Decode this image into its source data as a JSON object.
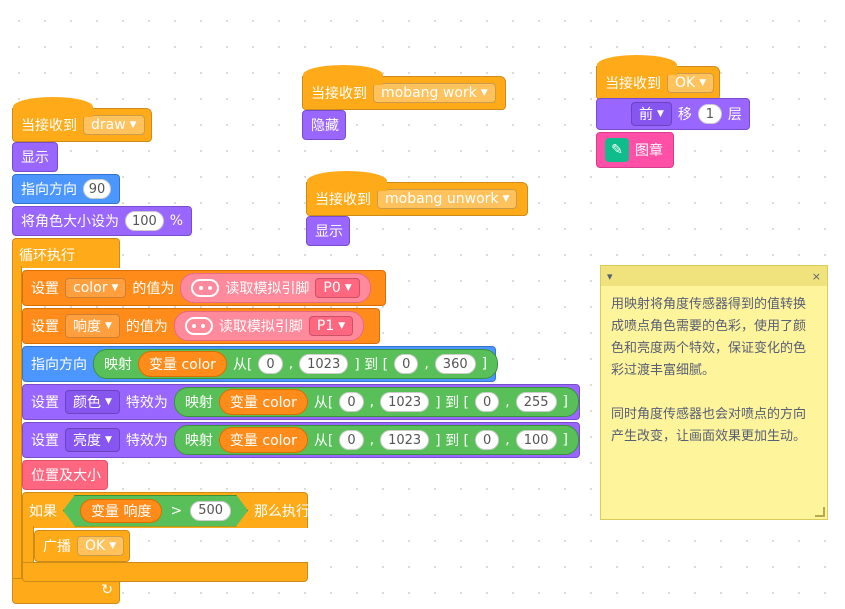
{
  "colors": {
    "events": "#ffab19",
    "looks": "#9966ff",
    "motion": "#4c97ff",
    "control": "#ffab19",
    "variables": "#ff8c1a",
    "operators": "#59c059",
    "pen": "#ff6680",
    "note_bg": "#fef49c"
  },
  "script_draw": {
    "hat_label": "当接收到",
    "hat_message": "draw",
    "show": "显示",
    "point_dir": "指向方向",
    "point_dir_value": "90",
    "set_size": "将角色大小设为",
    "set_size_value": "100",
    "set_size_unit": "%",
    "forever": "循环执行",
    "set1": "设置",
    "set1_var": "color",
    "set1_mid": "的值为",
    "set1_read": "读取模拟引脚",
    "set1_pin": "P0",
    "set2": "设置",
    "set2_var": "响度",
    "set2_mid": "的值为",
    "set2_read": "读取模拟引脚",
    "set2_pin": "P1",
    "dir2": "指向方向",
    "dir2_map": "映射",
    "dir2_var": "变量 color",
    "dir2_from": "从[",
    "dir2_a": "0",
    "dir2_comma1": ",",
    "dir2_b": "1023",
    "dir2_to": "] 到 [",
    "dir2_c": "0",
    "dir2_comma2": ",",
    "dir2_d": "360",
    "dir2_end": "]",
    "eff1": "设置",
    "eff1_name": "颜色",
    "eff1_mid": "特效为",
    "eff1_map": "映射",
    "eff1_var": "变量 color",
    "eff1_from": "从[",
    "eff1_a": "0",
    "eff1_comma1": ",",
    "eff1_b": "1023",
    "eff1_to": "] 到 [",
    "eff1_c": "0",
    "eff1_comma2": ",",
    "eff1_d": "255",
    "eff1_end": "]",
    "eff2": "设置",
    "eff2_name": "亮度",
    "eff2_mid": "特效为",
    "eff2_map": "映射",
    "eff2_var": "变量 color",
    "eff2_from": "从[",
    "eff2_a": "0",
    "eff2_comma1": ",",
    "eff2_b": "1023",
    "eff2_to": "] 到 [",
    "eff2_c": "0",
    "eff2_comma2": ",",
    "eff2_d": "100",
    "eff2_end": "]",
    "pos_size": "位置及大小",
    "if": "如果",
    "if_var": "变量 响度",
    "if_op": ">",
    "if_value": "500",
    "if_then": "那么执行",
    "broadcast": "广播",
    "broadcast_msg": "OK",
    "loop_arrow": "↻"
  },
  "script_work": {
    "hat_label": "当接收到",
    "hat_message": "mobang work",
    "hide": "隐藏"
  },
  "script_unwork": {
    "hat_label": "当接收到",
    "hat_message": "mobang unwork",
    "show": "显示"
  },
  "script_ok": {
    "hat_label": "当接收到",
    "hat_message": "OK",
    "layer_dir": "前",
    "move": "移",
    "layer_value": "1",
    "layer": "层",
    "stamp": "图章"
  },
  "note": {
    "collapse": "▾",
    "close": "×",
    "text": "用映射将角度传感器得到的值转换成喷点角色需要的色彩，使用了颜色和亮度两个特效，保证变化的色彩过渡丰富细腻。\n\n同时角度传感器也会对喷点的方向产生改变，让画面效果更加生动。"
  }
}
